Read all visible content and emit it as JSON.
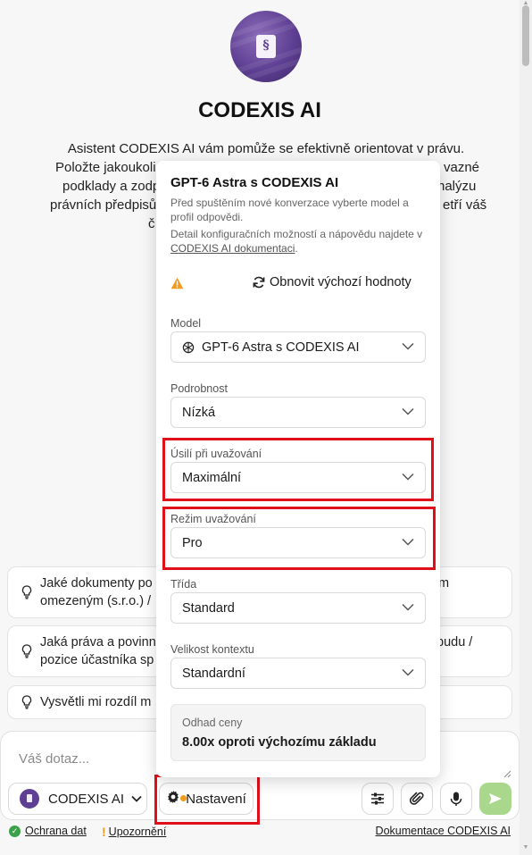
{
  "header": {
    "title": "CODEXIS AI",
    "intro_lines": [
      "Asistent CODEXIS AI vám pomůže se efektivně orientovat v právu.",
      "Položte jakoukoli",
      "vazné",
      "podklady a zodpo",
      "nalýzu",
      "právních předpisů",
      "etří váš",
      "č"
    ]
  },
  "suggestions": [
    {
      "line1_left": "Jaké dokumenty po",
      "line1_right": "m",
      "line2": "omezeným (s.r.o.) /"
    },
    {
      "line1_left": "Jaká práva a povinn",
      "line1_right": "budu /",
      "line2": "pozice účastníka sp"
    },
    {
      "line1_left": "Vysvětli mi rozdíl m",
      "line1_right": "",
      "line2": ""
    }
  ],
  "composer": {
    "placeholder": "Váš dotaz...",
    "assistant_label": "CODEXIS AI",
    "settings_label": "Nastavení"
  },
  "footer": {
    "data_protection": "Ochrana dat",
    "warnings": "Upozornění",
    "docs": "Dokumentace CODEXIS AI"
  },
  "settings": {
    "title": "GPT-6 Astra s CODEXIS AI",
    "description": "Před spuštěním nové konverzace vyberte model a profil odpovědi.",
    "details_prefix": "Detail konfiguračních možností a nápovědu najdete v",
    "details_link": "CODEXIS AI dokumentaci",
    "details_suffix": ".",
    "reset_label": "Obnovit výchozí hodnoty",
    "fields": {
      "model": {
        "label": "Model",
        "value": "GPT-6 Astra s CODEXIS AI"
      },
      "detail": {
        "label": "Podrobnost",
        "value": "Nízká"
      },
      "effort": {
        "label": "Úsilí při uvažování",
        "value": "Maximální"
      },
      "mode": {
        "label": "Režim uvažování",
        "value": "Pro"
      },
      "tier": {
        "label": "Třída",
        "value": "Standard"
      },
      "context": {
        "label": "Velikost kontextu",
        "value": "Standardní"
      }
    },
    "estimate": {
      "label": "Odhad ceny",
      "value": "8.00x oproti výchozímu základu"
    }
  },
  "colors": {
    "highlight": "#e0101a",
    "brand_purple": "#5e3f93",
    "send_green": "#a9d88d",
    "warning_orange": "#f29b1d"
  }
}
